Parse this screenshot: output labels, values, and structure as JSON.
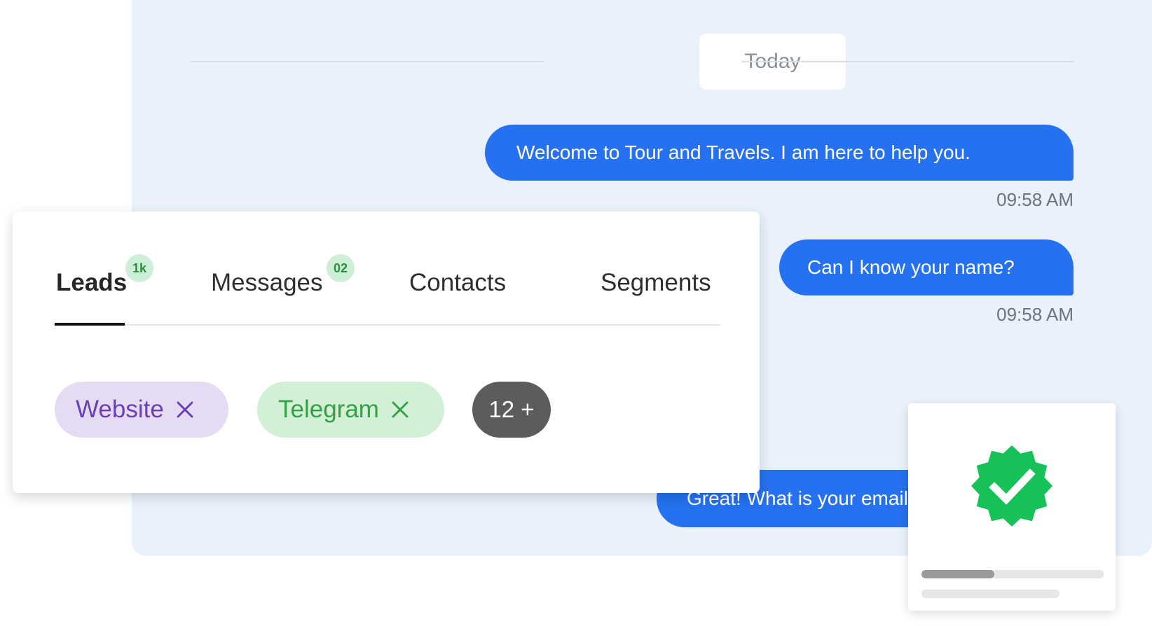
{
  "chat": {
    "date_label": "Today",
    "messages": [
      {
        "text": "Welcome to Tour and Travels. I am here to help you.",
        "time": "09:58 AM"
      },
      {
        "text": "Can I know your name?",
        "time": "09:58 AM"
      },
      {
        "text": "Great! What is your email?",
        "time": ""
      }
    ]
  },
  "leads_panel": {
    "tabs": [
      {
        "label": "Leads",
        "badge": "1k",
        "active": true
      },
      {
        "label": "Messages",
        "badge": "02",
        "active": false
      },
      {
        "label": "Contacts",
        "badge": "",
        "active": false
      },
      {
        "label": "Segments",
        "badge": "",
        "active": false
      }
    ],
    "filters": [
      {
        "label": "Website"
      },
      {
        "label": "Telegram"
      }
    ],
    "more_label": "12 +"
  },
  "verification": {
    "icon": "verified-badge-icon",
    "progress": 0.4
  },
  "colors": {
    "accent_blue": "#2571ef",
    "panel_bg": "#e9f1fc",
    "website_chip": "#e5dcf4",
    "telegram_chip": "#d2f0d6",
    "verified_green": "#16c257"
  }
}
